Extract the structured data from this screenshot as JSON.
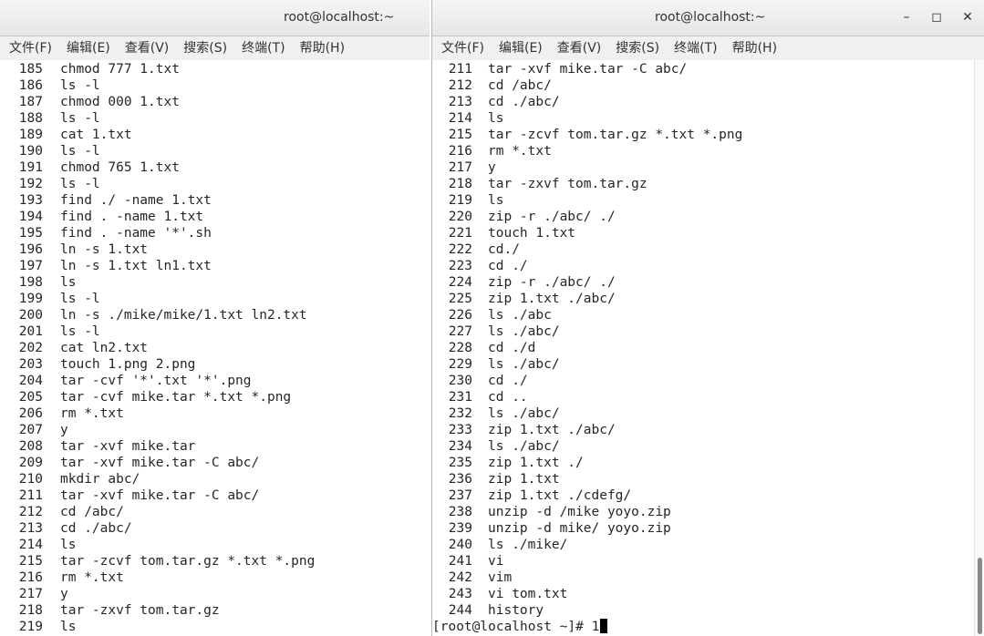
{
  "left_window": {
    "title": "root@localhost:~",
    "menu": [
      "文件(F)",
      "编辑(E)",
      "查看(V)",
      "搜索(S)",
      "终端(T)",
      "帮助(H)"
    ],
    "lines": [
      {
        "n": "185",
        "c": "chmod 777 1.txt"
      },
      {
        "n": "186",
        "c": "ls -l"
      },
      {
        "n": "187",
        "c": "chmod 000 1.txt"
      },
      {
        "n": "188",
        "c": "ls -l"
      },
      {
        "n": "189",
        "c": "cat 1.txt"
      },
      {
        "n": "190",
        "c": "ls -l"
      },
      {
        "n": "191",
        "c": "chmod 765 1.txt"
      },
      {
        "n": "192",
        "c": "ls -l"
      },
      {
        "n": "193",
        "c": "find ./ -name 1.txt"
      },
      {
        "n": "194",
        "c": "find . -name 1.txt"
      },
      {
        "n": "195",
        "c": "find . -name '*'.sh"
      },
      {
        "n": "196",
        "c": "ln -s 1.txt"
      },
      {
        "n": "197",
        "c": "ln -s 1.txt ln1.txt"
      },
      {
        "n": "198",
        "c": "ls"
      },
      {
        "n": "199",
        "c": "ls -l"
      },
      {
        "n": "200",
        "c": "ln -s ./mike/mike/1.txt ln2.txt"
      },
      {
        "n": "201",
        "c": "ls -l"
      },
      {
        "n": "202",
        "c": "cat ln2.txt"
      },
      {
        "n": "203",
        "c": "touch 1.png 2.png"
      },
      {
        "n": "204",
        "c": "tar -cvf '*'.txt '*'.png"
      },
      {
        "n": "205",
        "c": "tar -cvf mike.tar *.txt *.png"
      },
      {
        "n": "206",
        "c": "rm *.txt"
      },
      {
        "n": "207",
        "c": "y"
      },
      {
        "n": "208",
        "c": "tar -xvf mike.tar"
      },
      {
        "n": "209",
        "c": "tar -xvf mike.tar -C abc/"
      },
      {
        "n": "210",
        "c": "mkdir abc/"
      },
      {
        "n": "211",
        "c": "tar -xvf mike.tar -C abc/"
      },
      {
        "n": "212",
        "c": "cd /abc/"
      },
      {
        "n": "213",
        "c": "cd ./abc/"
      },
      {
        "n": "214",
        "c": "ls"
      },
      {
        "n": "215",
        "c": "tar -zcvf tom.tar.gz *.txt *.png"
      },
      {
        "n": "216",
        "c": "rm *.txt"
      },
      {
        "n": "217",
        "c": "y"
      },
      {
        "n": "218",
        "c": "tar -zxvf tom.tar.gz"
      },
      {
        "n": "219",
        "c": "ls"
      }
    ]
  },
  "right_window": {
    "title": "root@localhost:~",
    "controls": {
      "minimize": "–",
      "maximize": "◻",
      "close": "✕"
    },
    "menu": [
      "文件(F)",
      "编辑(E)",
      "查看(V)",
      "搜索(S)",
      "终端(T)",
      "帮助(H)"
    ],
    "lines": [
      {
        "n": "211",
        "c": "tar -xvf mike.tar -C abc/"
      },
      {
        "n": "212",
        "c": "cd /abc/"
      },
      {
        "n": "213",
        "c": "cd ./abc/"
      },
      {
        "n": "214",
        "c": "ls"
      },
      {
        "n": "215",
        "c": "tar -zcvf tom.tar.gz *.txt *.png"
      },
      {
        "n": "216",
        "c": "rm *.txt"
      },
      {
        "n": "217",
        "c": "y"
      },
      {
        "n": "218",
        "c": "tar -zxvf tom.tar.gz"
      },
      {
        "n": "219",
        "c": "ls"
      },
      {
        "n": "220",
        "c": "zip -r ./abc/ ./"
      },
      {
        "n": "221",
        "c": "touch 1.txt"
      },
      {
        "n": "222",
        "c": "cd./"
      },
      {
        "n": "223",
        "c": "cd ./"
      },
      {
        "n": "224",
        "c": "zip -r ./abc/ ./"
      },
      {
        "n": "225",
        "c": "zip 1.txt ./abc/"
      },
      {
        "n": "226",
        "c": "ls ./abc"
      },
      {
        "n": "227",
        "c": "ls ./abc/"
      },
      {
        "n": "228",
        "c": "cd ./d"
      },
      {
        "n": "229",
        "c": "ls ./abc/"
      },
      {
        "n": "230",
        "c": "cd ./"
      },
      {
        "n": "231",
        "c": "cd .."
      },
      {
        "n": "232",
        "c": "ls ./abc/"
      },
      {
        "n": "233",
        "c": "zip 1.txt ./abc/"
      },
      {
        "n": "234",
        "c": "ls ./abc/"
      },
      {
        "n": "235",
        "c": "zip 1.txt ./"
      },
      {
        "n": "236",
        "c": "zip 1.txt"
      },
      {
        "n": "237",
        "c": "zip 1.txt ./cdefg/"
      },
      {
        "n": "238",
        "c": "unzip -d /mike yoyo.zip"
      },
      {
        "n": "239",
        "c": "unzip -d mike/ yoyo.zip"
      },
      {
        "n": "240",
        "c": "ls ./mike/"
      },
      {
        "n": "241",
        "c": "vi"
      },
      {
        "n": "242",
        "c": "vim"
      },
      {
        "n": "243",
        "c": "vi tom.txt"
      },
      {
        "n": "244",
        "c": "history"
      }
    ],
    "prompt": "[root@localhost ~]# 1"
  }
}
